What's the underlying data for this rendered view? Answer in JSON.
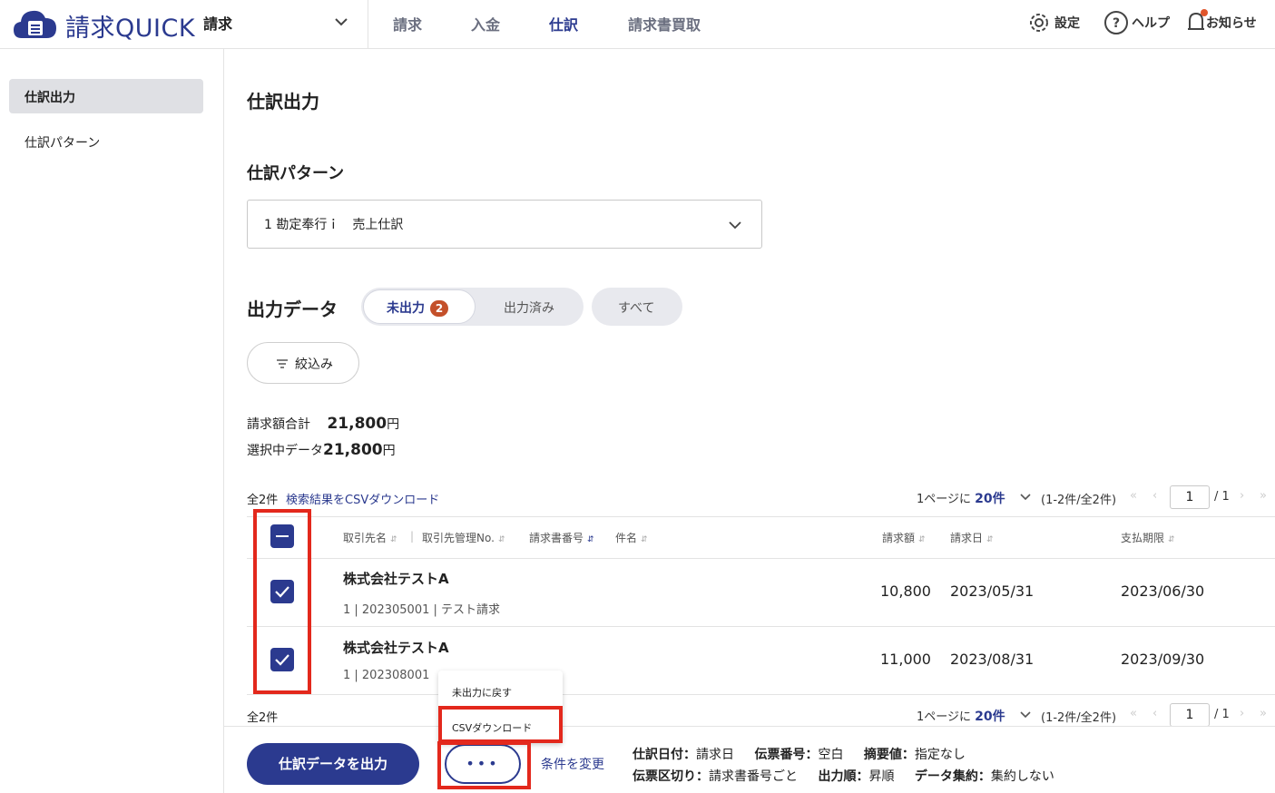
{
  "header": {
    "logo_text": "請求QUICK",
    "product_select": "請求",
    "nav": [
      "請求",
      "入金",
      "仕訳",
      "請求書買取"
    ],
    "active_nav": "仕訳",
    "settings_label": "設定",
    "help_label": "ヘルプ",
    "notice_label": "お知らせ"
  },
  "sidebar": {
    "items": [
      {
        "label": "仕訳出力",
        "active": true
      },
      {
        "label": "仕訳パターン",
        "active": false
      }
    ]
  },
  "main": {
    "title": "仕訳出力",
    "pattern_heading": "仕訳パターン",
    "pattern_select": "1 勘定奉行ｉ　売上仕訳",
    "output_heading": "出力データ",
    "tabs": {
      "unexported": "未出力",
      "unexported_count": "2",
      "exported": "出力済み",
      "all": "すべて"
    },
    "filter_label": "絞込み",
    "summary": {
      "total_label": "請求額合計",
      "total_value": "21,800",
      "total_unit": "円",
      "selected_label": "選択中データ",
      "selected_value": "21,800",
      "selected_unit": "円"
    },
    "list_count": "全2件",
    "csv_search_link": "検索結果をCSVダウンロード",
    "pager": {
      "per_page_prefix": "1ページに",
      "per_page_value": "20件",
      "range": "(1-2件/全2件)",
      "page_input": "1",
      "page_total": "/ 1"
    },
    "table": {
      "headers": {
        "client": "取引先名",
        "client_no": "取引先管理No.",
        "invoice_no": "請求書番号",
        "subject": "件名",
        "amount": "請求額",
        "invoice_date": "請求日",
        "due_date": "支払期限"
      },
      "rows": [
        {
          "client": "株式会社テストA",
          "info": "1 | 202305001 | テスト請求",
          "amount": "10,800",
          "invoice_date": "2023/05/31",
          "due_date": "2023/06/30",
          "checked": true
        },
        {
          "client": "株式会社テストA",
          "info": "1 | 202308001",
          "amount": "11,000",
          "invoice_date": "2023/08/31",
          "due_date": "2023/09/30",
          "checked": true
        }
      ]
    },
    "bottom_count": "全2件",
    "popup_menu": [
      "未出力に戻す",
      "CSVダウンロード"
    ]
  },
  "footer": {
    "primary_button": "仕訳データを出力",
    "more_button": "•••",
    "change_link": "条件を変更",
    "conditions_line1": [
      {
        "k": "仕訳日付：",
        "v": "請求日"
      },
      {
        "k": "伝票番号：",
        "v": "空白"
      },
      {
        "k": "摘要値：",
        "v": "指定なし"
      }
    ],
    "conditions_line2": [
      {
        "k": "伝票区切り：",
        "v": "請求書番号ごと"
      },
      {
        "k": "出力順：",
        "v": "昇順"
      },
      {
        "k": "データ集約：",
        "v": "集約しない"
      }
    ]
  },
  "colors": {
    "accent": "#2b3a8f",
    "badge": "#c4502a",
    "highlight": "#e3281c"
  }
}
